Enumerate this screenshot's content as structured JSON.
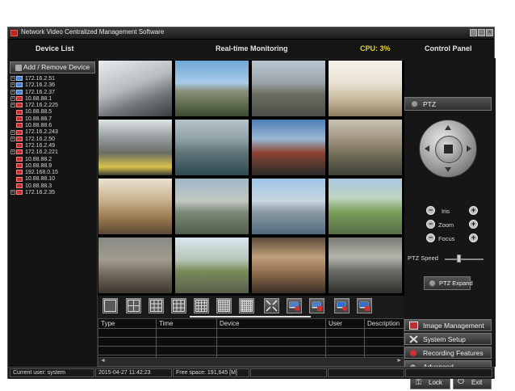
{
  "window": {
    "title": "Network Video Centralized Management Software",
    "controls": [
      "_",
      "□",
      "×"
    ]
  },
  "header": {
    "device_list": "Device List",
    "monitoring": "Real-time Monitoring",
    "cpu": "CPU: 3%",
    "control_panel": "Control Panel"
  },
  "left": {
    "add_remove": "Add / Remove Device",
    "devices": [
      {
        "ip": "172.16.2.51",
        "expandable": true,
        "online": true
      },
      {
        "ip": "172.16.2.36",
        "expandable": true,
        "online": true
      },
      {
        "ip": "172.16.2.37",
        "expandable": true,
        "online": true
      },
      {
        "ip": "10.88.88.1",
        "expandable": true,
        "online": false
      },
      {
        "ip": "172.16.2.225",
        "expandable": true,
        "online": false
      },
      {
        "ip": "10.88.88.5",
        "expandable": false,
        "online": false
      },
      {
        "ip": "10.88.88.7",
        "expandable": false,
        "online": false
      },
      {
        "ip": "10.88.88.6",
        "expandable": false,
        "online": false
      },
      {
        "ip": "172.16.2.243",
        "expandable": true,
        "online": false
      },
      {
        "ip": "172.16.2.50",
        "expandable": true,
        "online": false
      },
      {
        "ip": "172.16.2.49",
        "expandable": false,
        "online": false
      },
      {
        "ip": "172.16.2.221",
        "expandable": true,
        "online": false
      },
      {
        "ip": "10.88.88.2",
        "expandable": false,
        "online": false
      },
      {
        "ip": "10.88.88.9",
        "expandable": false,
        "online": false
      },
      {
        "ip": "192.168.0.15",
        "expandable": false,
        "online": false
      },
      {
        "ip": "10.88.88.10",
        "expandable": false,
        "online": false
      },
      {
        "ip": "10.88.88.3",
        "expandable": false,
        "online": false
      },
      {
        "ip": "172.16.2.35",
        "expandable": true,
        "online": false
      }
    ]
  },
  "layouts": [
    "1-view",
    "4-view",
    "6-view",
    "9-view",
    "13-view",
    "16-view",
    "25-view",
    "fullscreen",
    "record",
    "stop-record",
    "play-all",
    "stop-all"
  ],
  "events": {
    "columns": [
      "Type",
      "Time",
      "Device",
      "User",
      "Description"
    ]
  },
  "control": {
    "ptz": "PTZ",
    "iris": "Iris",
    "zoom": "Zoom",
    "focus": "Focus",
    "ptz_speed": "PTZ Speed",
    "ptz_speed_level": 0.35,
    "ptz_expand": "PTZ Expand",
    "menu": [
      {
        "label": "Image Management",
        "icon": "image-icon"
      },
      {
        "label": "System Setup",
        "icon": "tools-icon"
      },
      {
        "label": "Recording Features",
        "icon": "record-icon"
      },
      {
        "label": "Advanced",
        "icon": "gear-icon"
      }
    ],
    "lock": "Lock",
    "exit": "Exit"
  },
  "status": {
    "user": "Current user: system",
    "datetime": "2015-04-27 11:42:23",
    "free_space": "Free space: 191,645 [M]"
  },
  "colors": {
    "cpu": "#e8d23a",
    "online": "#4a7fd0",
    "offline": "#c03030"
  }
}
